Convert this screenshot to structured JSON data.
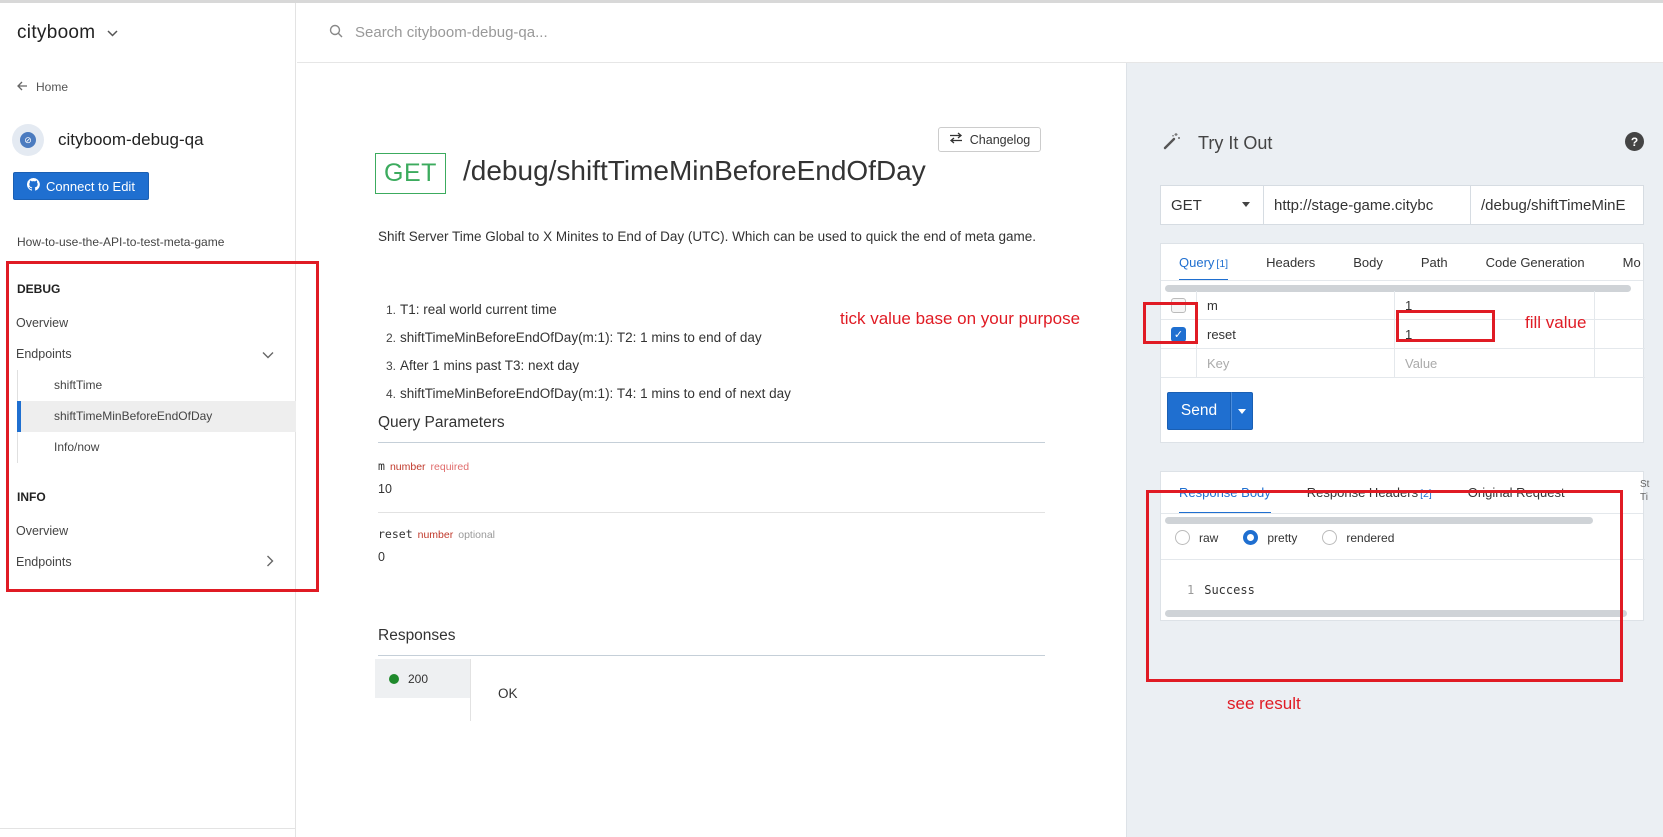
{
  "sidebar": {
    "brand": "cityboom",
    "home": "Home",
    "project_name": "cityboom-debug-qa",
    "connect_button": "Connect to Edit",
    "doc_link": "How-to-use-the-API-to-test-meta-game",
    "debug_section": "DEBUG",
    "debug_overview": "Overview",
    "debug_endpoints": "Endpoints",
    "debug_sub": [
      "shiftTime",
      "shiftTimeMinBeforeEndOfDay",
      "Info/now"
    ],
    "info_section": "INFO",
    "info_overview": "Overview",
    "info_endpoints": "Endpoints"
  },
  "search": {
    "placeholder": "Search cityboom-debug-qa..."
  },
  "main": {
    "changelog": "Changelog",
    "method": "GET",
    "path": "/debug/shiftTimeMinBeforeEndOfDay",
    "description": "Shift Server Time Global to X Minites to End of Day (UTC). Which can be used to quick the end of meta game.",
    "steps": [
      "T1: real world current time",
      "shiftTimeMinBeforeEndOfDay(m:1): T2: 1 mins to end of day",
      "After 1 mins past T3: next day",
      "shiftTimeMinBeforeEndOfDay(m:1): T4: 1 mins to end of next day"
    ],
    "query_params_title": "Query Parameters",
    "params": [
      {
        "name": "m",
        "type": "number",
        "flag": "required",
        "value": "10"
      },
      {
        "name": "reset",
        "type": "number",
        "flag": "optional",
        "value": "0"
      }
    ],
    "responses_title": "Responses",
    "response_code": "200",
    "response_text": "OK"
  },
  "panel": {
    "title": "Try It Out",
    "method": "GET",
    "base_url": "http://stage-game.citybc",
    "path": "/debug/shiftTimeMinE",
    "request_tabs": [
      "Query",
      "Headers",
      "Body",
      "Path",
      "Code Generation",
      "Mo"
    ],
    "query_count": "[1]",
    "query_rows": [
      {
        "checked": false,
        "key": "m",
        "value": "1"
      },
      {
        "checked": true,
        "key": "reset",
        "value": "1"
      }
    ],
    "key_placeholder": "Key",
    "value_placeholder": "Value",
    "send": "Send",
    "response_tabs": [
      "Response Body",
      "Response Headers",
      "Original Request"
    ],
    "response_headers_count": "[2]",
    "response_edge_fragment": [
      "St",
      "Ti"
    ],
    "formats": [
      "raw",
      "pretty",
      "rendered"
    ],
    "selected_format": "pretty",
    "line_number": "1",
    "response_body": "Success"
  },
  "annotations": {
    "tick_note": "tick value base on your purpose",
    "fill_note": "fill value",
    "result_note": "see result",
    "color": "#e01b24"
  },
  "colors": {
    "accent": "#1f6fd0",
    "get_green": "#3cab5e",
    "status_green": "#1f8a2c"
  }
}
